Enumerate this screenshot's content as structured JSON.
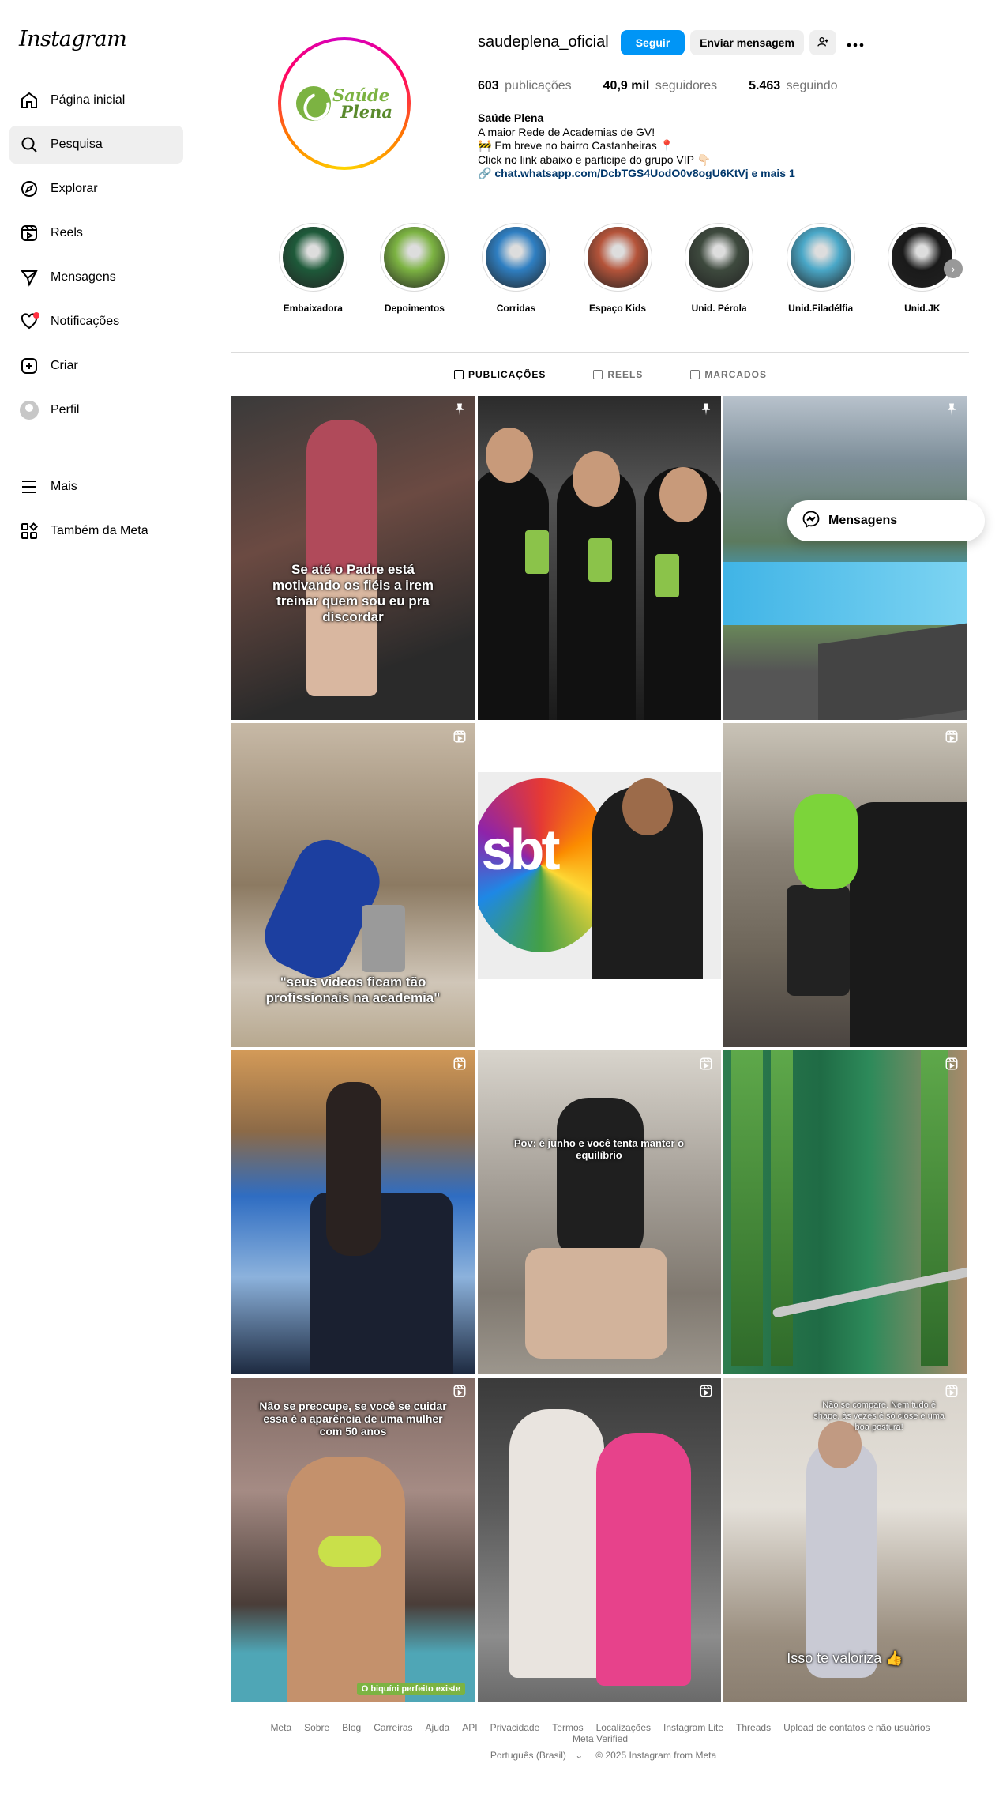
{
  "app": {
    "logo": "Instagram"
  },
  "sidebar": {
    "items": [
      {
        "label": "Página inicial",
        "icon": "home-icon"
      },
      {
        "label": "Pesquisa",
        "icon": "search-icon",
        "active": true
      },
      {
        "label": "Explorar",
        "icon": "compass-icon"
      },
      {
        "label": "Reels",
        "icon": "reels-icon"
      },
      {
        "label": "Mensagens",
        "icon": "messenger-icon"
      },
      {
        "label": "Notificações",
        "icon": "heart-icon",
        "dot": true
      },
      {
        "label": "Criar",
        "icon": "plus-square-icon"
      },
      {
        "label": "Perfil",
        "icon": "avatar-icon"
      }
    ],
    "bottom": [
      {
        "label": "Mais",
        "icon": "menu-icon"
      },
      {
        "label": "Também da Meta",
        "icon": "meta-grid-icon"
      }
    ]
  },
  "profile": {
    "username": "saudeplena_oficial",
    "follow_label": "Seguir",
    "message_label": "Enviar mensagem",
    "logo_text_line1": "Saúde",
    "logo_text_line2": "Plena",
    "stats": {
      "posts_value": "603",
      "posts_label": "publicações",
      "followers_value": "40,9 mil",
      "followers_label": "seguidores",
      "following_value": "5.463",
      "following_label": "seguindo"
    },
    "bio": {
      "name": "Saúde Plena",
      "line1": "A maior Rede de Academias de GV!",
      "line2": "🚧 Em breve no bairro Castanheiras 📍",
      "line3": "Click no link abaixo e participe do grupo VIP 👇🏻",
      "link": "chat.whatsapp.com/DcbTGS4UodO0v8ogU6KtVj e mais 1"
    }
  },
  "highlights": [
    {
      "label": "Embaixadora",
      "color": "#1e5a3a"
    },
    {
      "label": "Depoimentos",
      "color": "#7cb342"
    },
    {
      "label": "Corridas",
      "color": "#2f7fc2"
    },
    {
      "label": "Espaço Kids",
      "color": "#b5543a"
    },
    {
      "label": "Unid. Pérola",
      "color": "#3e4a3e"
    },
    {
      "label": "Unid.Filadélfia",
      "color": "#4aa8c8"
    },
    {
      "label": "Unid.JK",
      "color": "#1a1a1a"
    }
  ],
  "tabs": [
    {
      "label": "PUBLICAÇÕES",
      "active": true
    },
    {
      "label": "REELS"
    },
    {
      "label": "MARCADOS"
    }
  ],
  "posts": [
    {
      "caption": "Se até o Padre está motivando os fiéis a irem treinar quem sou eu pra discordar",
      "badge": "pin-icon"
    },
    {
      "caption": "",
      "badge": "pin-icon"
    },
    {
      "caption": "",
      "badge": "pin-icon"
    },
    {
      "caption": "\"seus videos ficam tão profissionais na academia\"",
      "badge": "reel-icon"
    },
    {
      "caption": "",
      "badge": ""
    },
    {
      "caption": "",
      "badge": "reel-icon"
    },
    {
      "caption": "",
      "badge": "reel-icon"
    },
    {
      "caption": "Pov: é junho e você tenta manter o equilíbrio",
      "badge": "reel-icon"
    },
    {
      "caption": "",
      "badge": "reel-icon"
    },
    {
      "caption": "Não se preocupe, se você se cuidar essa é a aparência de uma mulher com 50 anos",
      "badge": "reel-icon",
      "pill": "O biquíni perfeito existe"
    },
    {
      "caption": "",
      "badge": "reel-icon"
    },
    {
      "caption": "Não se compare. Nem tudo é shape, às vezes é só close e uma boa postura!",
      "caption2": "Isso te valoriza 👍",
      "badge": "reel-icon"
    }
  ],
  "floating": {
    "label": "Mensagens"
  },
  "footer": {
    "links": [
      "Meta",
      "Sobre",
      "Blog",
      "Carreiras",
      "Ajuda",
      "API",
      "Privacidade",
      "Termos",
      "Localizações",
      "Instagram Lite",
      "Threads",
      "Upload de contatos e não usuários",
      "Meta Verified"
    ],
    "language": "Português (Brasil)",
    "copyright": "© 2025 Instagram from Meta"
  }
}
